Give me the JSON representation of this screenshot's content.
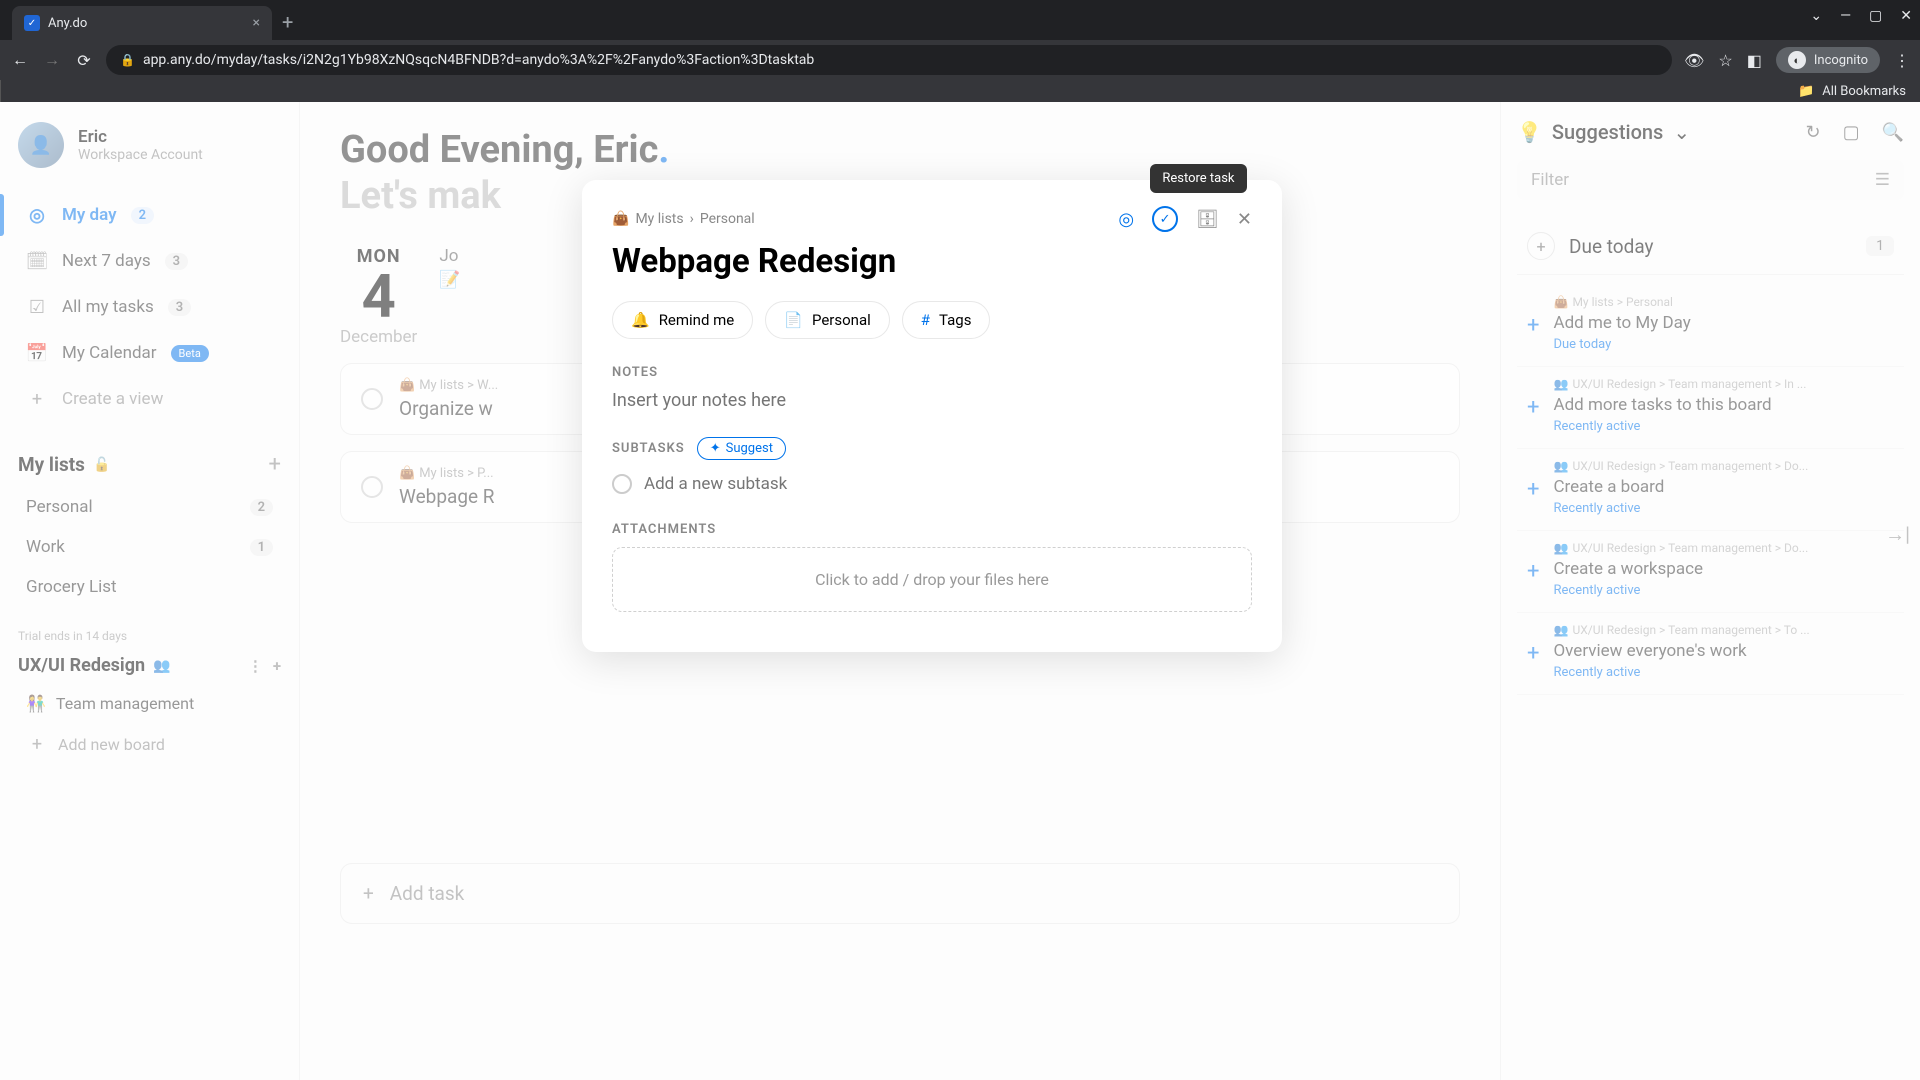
{
  "browser": {
    "tab_title": "Any.do",
    "url": "app.any.do/myday/tasks/i2N2g1Yb98XzNQsqcN4BFNDB?d=anydo%3A%2F%2Fanydo%3Faction%3Dtasktab",
    "incognito_label": "Incognito",
    "all_bookmarks": "All Bookmarks"
  },
  "user": {
    "name": "Eric",
    "subtitle": "Workspace Account"
  },
  "sidebar": {
    "myday": "My day",
    "myday_badge": "2",
    "next7": "Next 7 days",
    "next7_badge": "3",
    "alltasks": "All my tasks",
    "alltasks_badge": "3",
    "calendar": "My Calendar",
    "calendar_badge": "Beta",
    "create_view": "Create a view",
    "mylists_title": "My lists",
    "lists": [
      {
        "name": "Personal",
        "badge": "2"
      },
      {
        "name": "Work",
        "badge": "1"
      },
      {
        "name": "Grocery List",
        "badge": ""
      }
    ],
    "trial": "Trial ends in 14 days",
    "workspace": "UX/UI Redesign",
    "board": "Team management",
    "add_board": "Add new board"
  },
  "main": {
    "greeting": "Good Evening, Eric",
    "greeting_sub": "Let's mak",
    "day": "MON",
    "date": "4",
    "month": "December",
    "agenda": "Jo",
    "tasks": [
      {
        "crumb": "My lists > W...",
        "title": "Organize w"
      },
      {
        "crumb": "My lists > P...",
        "title": "Webpage R"
      }
    ],
    "add_task": "Add task"
  },
  "right": {
    "suggestions": "Suggestions",
    "filter": "Filter",
    "due_today_header": "Due today",
    "due_today_count": "1",
    "cards": [
      {
        "crumb": "My lists > Personal",
        "title": "Add me to My Day",
        "meta": "Due today"
      },
      {
        "crumb": "UX/UI Redesign > Team management > In ...",
        "title": "Add more tasks to this board",
        "meta": "Recently active"
      },
      {
        "crumb": "UX/UI Redesign > Team management > Do...",
        "title": "Create a board",
        "meta": "Recently active"
      },
      {
        "crumb": "UX/UI Redesign > Team management > Do...",
        "title": "Create a workspace",
        "meta": "Recently active"
      },
      {
        "crumb": "UX/UI Redesign > Team management > To ...",
        "title": "Overview everyone's work",
        "meta": "Recently active"
      }
    ]
  },
  "modal": {
    "tooltip": "Restore task",
    "crumb_root": "My lists",
    "crumb_leaf": "Personal",
    "title": "Webpage Redesign",
    "chip_remind": "Remind me",
    "chip_personal": "Personal",
    "chip_tags": "Tags",
    "notes_label": "Notes",
    "notes_placeholder": "Insert your notes here",
    "subtasks_label": "Subtasks",
    "suggest": "Suggest",
    "subtask_placeholder": "Add a new subtask",
    "attachments_label": "Attachments",
    "attachments_drop": "Click to add / drop your files here"
  }
}
